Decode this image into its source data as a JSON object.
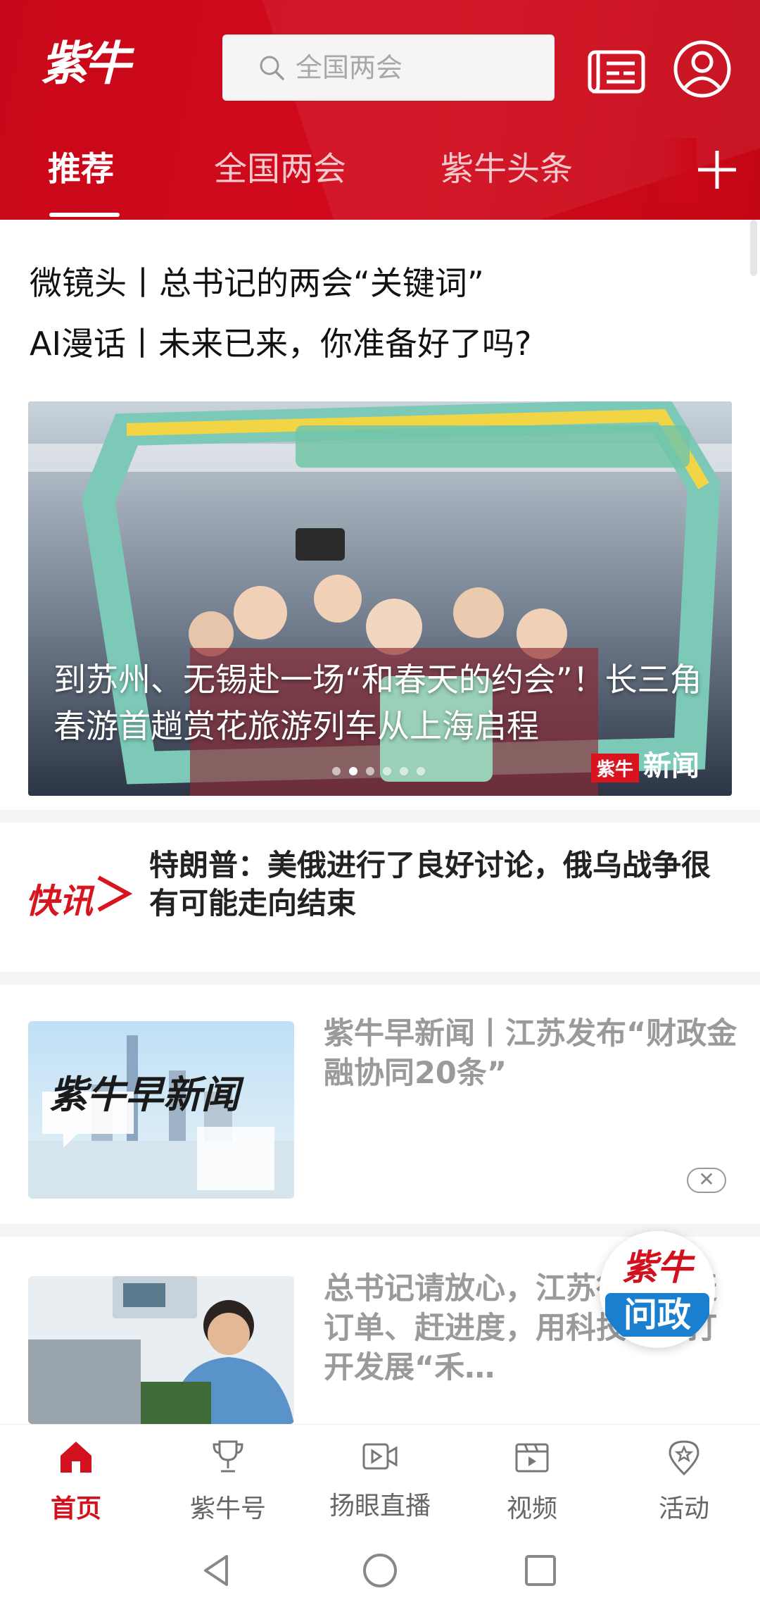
{
  "header": {
    "logo_text": "紫牛",
    "search_placeholder": "全国两会",
    "tabs": [
      {
        "label": "推荐",
        "active": true
      },
      {
        "label": "全国两会",
        "active": false
      },
      {
        "label": "紫牛头条",
        "active": false
      }
    ],
    "icons": [
      "search-icon",
      "newspaper-icon",
      "user-icon",
      "plus-icon"
    ]
  },
  "headlines": [
    "微镜头丨总书记的两会“关键词”",
    "AI漫话丨未来已来，你准备好了吗?"
  ],
  "banner": {
    "title": "到苏州、无锡赴一场“和春天的约会”！长三角春游首趟赏花旅游列车从上海启程",
    "dots_count": 6,
    "active_dot": 1,
    "watermark_seal": "紫牛",
    "watermark_text": "新闻"
  },
  "flash": {
    "logo_text": "快讯",
    "text": "特朗普：美俄进行了良好讨论，俄乌战争很有可能走向结束"
  },
  "news": [
    {
      "title": "紫牛早新闻丨江苏发布“财政金融协同20条”",
      "thumb_text": "紫牛早新闻"
    },
    {
      "title": "总书记请放心，江苏行！丨赶订单、赶进度，用科技创新打开发展“禾…"
    }
  ],
  "close_label": "✕",
  "float_badge": {
    "top": "紫牛",
    "bottom": "问政"
  },
  "bottom_nav": [
    {
      "label": "首页",
      "icon": "home-icon",
      "active": true
    },
    {
      "label": "紫牛号",
      "icon": "trophy-icon",
      "active": false
    },
    {
      "label": "扬眼直播",
      "icon": "live-video-icon",
      "active": false
    },
    {
      "label": "视频",
      "icon": "video-icon",
      "active": false
    },
    {
      "label": "活动",
      "icon": "star-location-icon",
      "active": false
    }
  ],
  "colors": {
    "brand_red": "#d20a1c",
    "nav_active": "#d2101e"
  }
}
